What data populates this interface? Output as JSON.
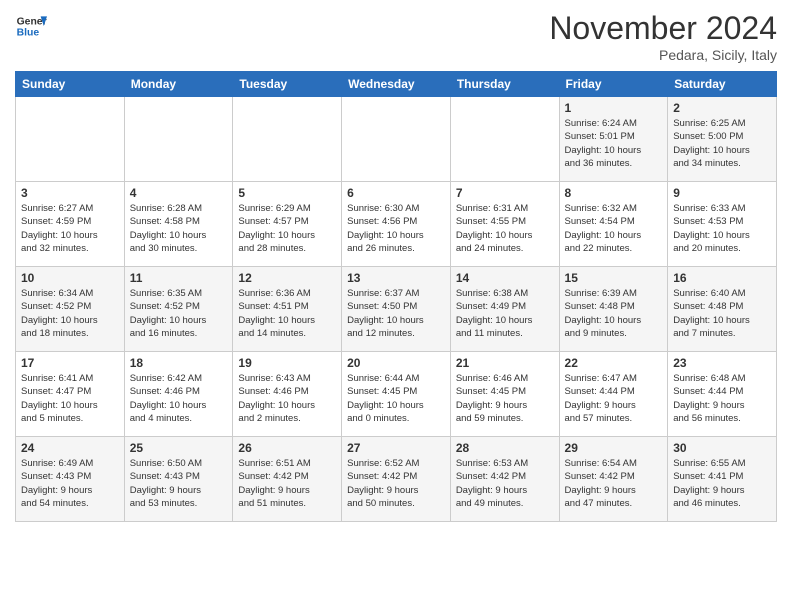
{
  "header": {
    "logo_line1": "General",
    "logo_line2": "Blue",
    "month_title": "November 2024",
    "location": "Pedara, Sicily, Italy"
  },
  "weekdays": [
    "Sunday",
    "Monday",
    "Tuesday",
    "Wednesday",
    "Thursday",
    "Friday",
    "Saturday"
  ],
  "weeks": [
    [
      {
        "day": "",
        "info": ""
      },
      {
        "day": "",
        "info": ""
      },
      {
        "day": "",
        "info": ""
      },
      {
        "day": "",
        "info": ""
      },
      {
        "day": "",
        "info": ""
      },
      {
        "day": "1",
        "info": "Sunrise: 6:24 AM\nSunset: 5:01 PM\nDaylight: 10 hours\nand 36 minutes."
      },
      {
        "day": "2",
        "info": "Sunrise: 6:25 AM\nSunset: 5:00 PM\nDaylight: 10 hours\nand 34 minutes."
      }
    ],
    [
      {
        "day": "3",
        "info": "Sunrise: 6:27 AM\nSunset: 4:59 PM\nDaylight: 10 hours\nand 32 minutes."
      },
      {
        "day": "4",
        "info": "Sunrise: 6:28 AM\nSunset: 4:58 PM\nDaylight: 10 hours\nand 30 minutes."
      },
      {
        "day": "5",
        "info": "Sunrise: 6:29 AM\nSunset: 4:57 PM\nDaylight: 10 hours\nand 28 minutes."
      },
      {
        "day": "6",
        "info": "Sunrise: 6:30 AM\nSunset: 4:56 PM\nDaylight: 10 hours\nand 26 minutes."
      },
      {
        "day": "7",
        "info": "Sunrise: 6:31 AM\nSunset: 4:55 PM\nDaylight: 10 hours\nand 24 minutes."
      },
      {
        "day": "8",
        "info": "Sunrise: 6:32 AM\nSunset: 4:54 PM\nDaylight: 10 hours\nand 22 minutes."
      },
      {
        "day": "9",
        "info": "Sunrise: 6:33 AM\nSunset: 4:53 PM\nDaylight: 10 hours\nand 20 minutes."
      }
    ],
    [
      {
        "day": "10",
        "info": "Sunrise: 6:34 AM\nSunset: 4:52 PM\nDaylight: 10 hours\nand 18 minutes."
      },
      {
        "day": "11",
        "info": "Sunrise: 6:35 AM\nSunset: 4:52 PM\nDaylight: 10 hours\nand 16 minutes."
      },
      {
        "day": "12",
        "info": "Sunrise: 6:36 AM\nSunset: 4:51 PM\nDaylight: 10 hours\nand 14 minutes."
      },
      {
        "day": "13",
        "info": "Sunrise: 6:37 AM\nSunset: 4:50 PM\nDaylight: 10 hours\nand 12 minutes."
      },
      {
        "day": "14",
        "info": "Sunrise: 6:38 AM\nSunset: 4:49 PM\nDaylight: 10 hours\nand 11 minutes."
      },
      {
        "day": "15",
        "info": "Sunrise: 6:39 AM\nSunset: 4:48 PM\nDaylight: 10 hours\nand 9 minutes."
      },
      {
        "day": "16",
        "info": "Sunrise: 6:40 AM\nSunset: 4:48 PM\nDaylight: 10 hours\nand 7 minutes."
      }
    ],
    [
      {
        "day": "17",
        "info": "Sunrise: 6:41 AM\nSunset: 4:47 PM\nDaylight: 10 hours\nand 5 minutes."
      },
      {
        "day": "18",
        "info": "Sunrise: 6:42 AM\nSunset: 4:46 PM\nDaylight: 10 hours\nand 4 minutes."
      },
      {
        "day": "19",
        "info": "Sunrise: 6:43 AM\nSunset: 4:46 PM\nDaylight: 10 hours\nand 2 minutes."
      },
      {
        "day": "20",
        "info": "Sunrise: 6:44 AM\nSunset: 4:45 PM\nDaylight: 10 hours\nand 0 minutes."
      },
      {
        "day": "21",
        "info": "Sunrise: 6:46 AM\nSunset: 4:45 PM\nDaylight: 9 hours\nand 59 minutes."
      },
      {
        "day": "22",
        "info": "Sunrise: 6:47 AM\nSunset: 4:44 PM\nDaylight: 9 hours\nand 57 minutes."
      },
      {
        "day": "23",
        "info": "Sunrise: 6:48 AM\nSunset: 4:44 PM\nDaylight: 9 hours\nand 56 minutes."
      }
    ],
    [
      {
        "day": "24",
        "info": "Sunrise: 6:49 AM\nSunset: 4:43 PM\nDaylight: 9 hours\nand 54 minutes."
      },
      {
        "day": "25",
        "info": "Sunrise: 6:50 AM\nSunset: 4:43 PM\nDaylight: 9 hours\nand 53 minutes."
      },
      {
        "day": "26",
        "info": "Sunrise: 6:51 AM\nSunset: 4:42 PM\nDaylight: 9 hours\nand 51 minutes."
      },
      {
        "day": "27",
        "info": "Sunrise: 6:52 AM\nSunset: 4:42 PM\nDaylight: 9 hours\nand 50 minutes."
      },
      {
        "day": "28",
        "info": "Sunrise: 6:53 AM\nSunset: 4:42 PM\nDaylight: 9 hours\nand 49 minutes."
      },
      {
        "day": "29",
        "info": "Sunrise: 6:54 AM\nSunset: 4:42 PM\nDaylight: 9 hours\nand 47 minutes."
      },
      {
        "day": "30",
        "info": "Sunrise: 6:55 AM\nSunset: 4:41 PM\nDaylight: 9 hours\nand 46 minutes."
      }
    ]
  ]
}
